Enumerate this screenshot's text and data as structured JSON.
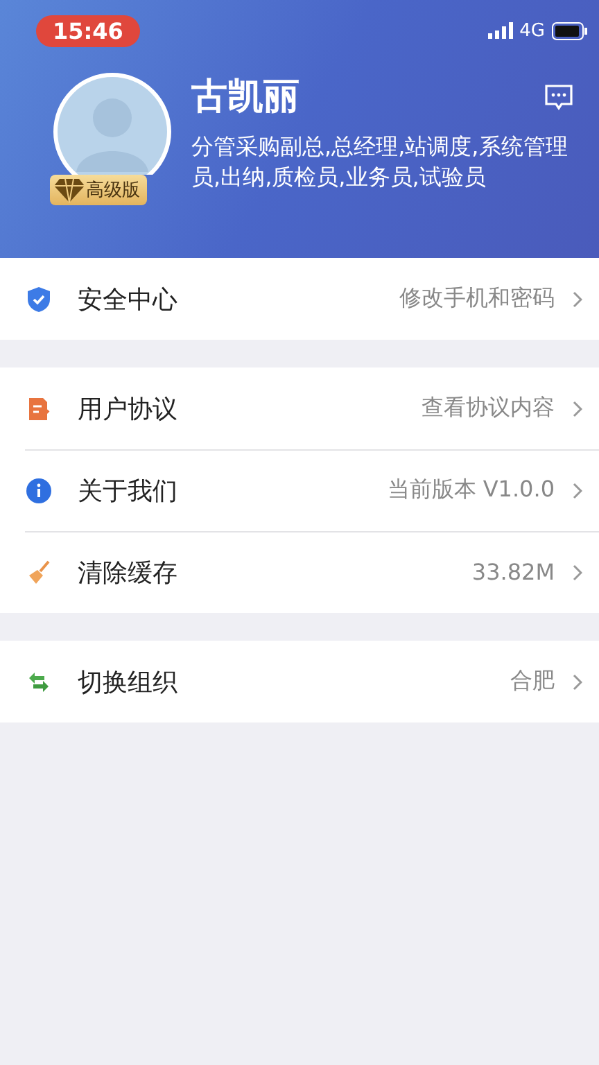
{
  "status_bar": {
    "time": "15:46",
    "network": "4G"
  },
  "profile": {
    "name": "古凯丽",
    "badge": "高级版",
    "roles": "分管采购副总,总经理,站调度,系统管理员,出纳,质检员,业务员,试验员"
  },
  "groups": [
    {
      "items": [
        {
          "kind": "shield",
          "label": "安全中心",
          "value": "修改手机和密码"
        }
      ]
    },
    {
      "items": [
        {
          "kind": "document",
          "label": "用户协议",
          "value": "查看协议内容"
        },
        {
          "kind": "info",
          "label": "关于我们",
          "value": "当前版本 V1.0.0"
        },
        {
          "kind": "broom",
          "label": "清除缓存",
          "value": "33.82M"
        }
      ]
    },
    {
      "items": [
        {
          "kind": "swap",
          "label": "切换组织",
          "value": "合肥"
        }
      ]
    }
  ]
}
